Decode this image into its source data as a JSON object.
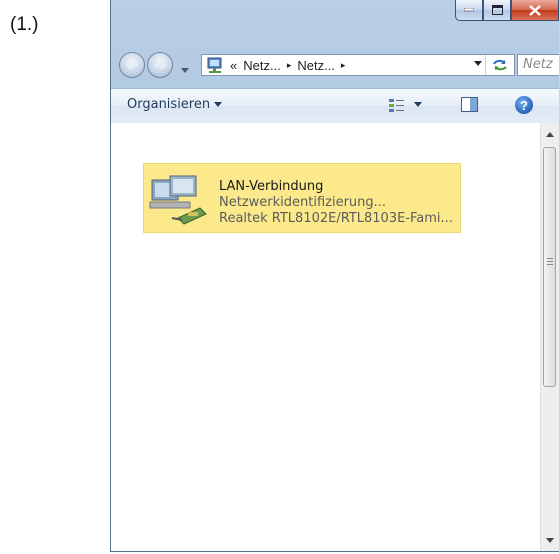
{
  "step_label": "(1.)",
  "address_bar": {
    "overflow_chevron": "«",
    "crumbs": [
      "Netz...",
      "Netz..."
    ],
    "separator": "▸"
  },
  "search": {
    "placeholder": "Netz"
  },
  "toolbar": {
    "organize_label": "Organisieren"
  },
  "items": [
    {
      "title": "LAN-Verbindung",
      "status": "Netzwerkidentifizierung...",
      "device": "Realtek RTL8102E/RTL8103E-Fami..."
    }
  ],
  "colors": {
    "selection": "#fbe98c",
    "close_button": "#c3391c",
    "titlebar": "#b9cfe6"
  },
  "icons": {
    "back": "back-arrow-icon",
    "forward": "forward-arrow-icon",
    "location": "network-folder-icon",
    "refresh": "refresh-icon",
    "views": "change-view-icon",
    "preview": "preview-pane-icon",
    "help": "help-icon",
    "item": "network-adapter-icon"
  }
}
